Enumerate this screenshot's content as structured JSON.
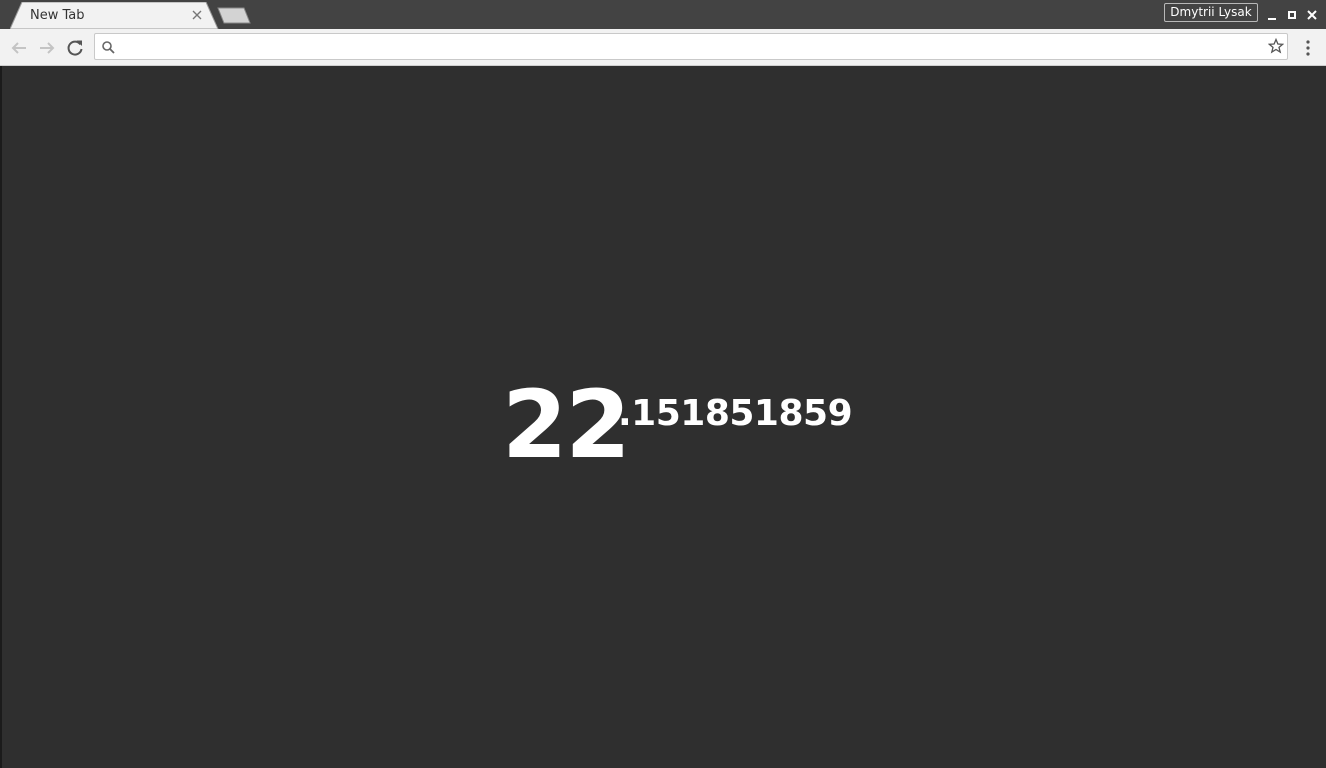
{
  "browser": {
    "tab": {
      "title": "New Tab"
    },
    "profile_name": "Dmytrii Lysak",
    "omnibox": {
      "value": "",
      "placeholder": ""
    }
  },
  "page": {
    "value_integer": "22",
    "value_fraction": ".151851859"
  },
  "icons": {
    "tab_close": "close-icon",
    "new_tab": "new-tab-icon",
    "minimize": "minimize-icon",
    "maximize": "maximize-icon",
    "close_window": "close-icon",
    "back": "arrow-left-icon",
    "forward": "arrow-right-icon",
    "reload": "reload-icon",
    "search": "search-icon",
    "bookmark": "star-icon",
    "menu": "kebab-menu-icon"
  },
  "colors": {
    "titlebar": "#434343",
    "toolbar": "#f2f2f2",
    "page_background": "#2f2f2f",
    "clock_text": "#ffffff"
  }
}
